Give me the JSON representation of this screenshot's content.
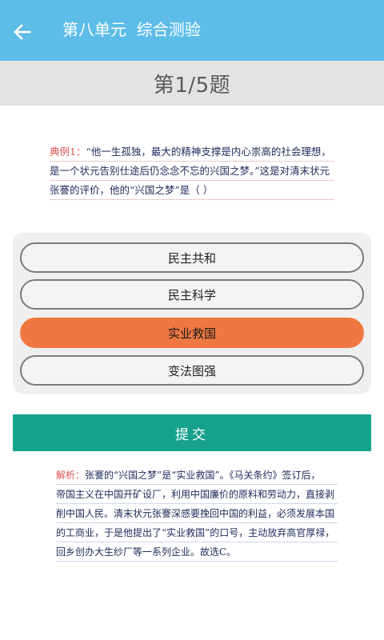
{
  "header": {
    "title": "第八单元  综合测验",
    "back_icon": "arrow-left-icon",
    "background_color": "#5dbde8"
  },
  "counter": {
    "text": "第1/5题"
  },
  "question": {
    "tag": "典例1：",
    "lines": [
      "“他一生孤独，最大的精神支撑是内心崇高的社会理想，",
      "是一个状元告别仕途后仍念念不忘的兴国之梦。”这是对清末状元",
      "张謇的评价，他的“兴国之梦”是（     ）"
    ]
  },
  "options": [
    {
      "label": "民主共和",
      "selected": false
    },
    {
      "label": "民主科学",
      "selected": false
    },
    {
      "label": "实业救国",
      "selected": true
    },
    {
      "label": "变法图强",
      "selected": false
    }
  ],
  "colors": {
    "selected": "#ef7842",
    "submit": "#16a08e"
  },
  "submit": {
    "label": "提交"
  },
  "analysis": {
    "tag": "解析：",
    "lines": [
      "张謇的“兴国之梦”是“实业救国”。《马关条约》签订后，",
      "帝国主义在中国开矿设厂，利用中国廉价的原料和劳动力，直接剥",
      "削中国人民。清末状元张謇深感要挽回中国的利益，必须发展本国",
      "的工商业，于是他提出了“实业救国”的口号，主动放弃高官厚禄，",
      "回乡创办大生纱厂等一系列企业。故选C。"
    ]
  }
}
